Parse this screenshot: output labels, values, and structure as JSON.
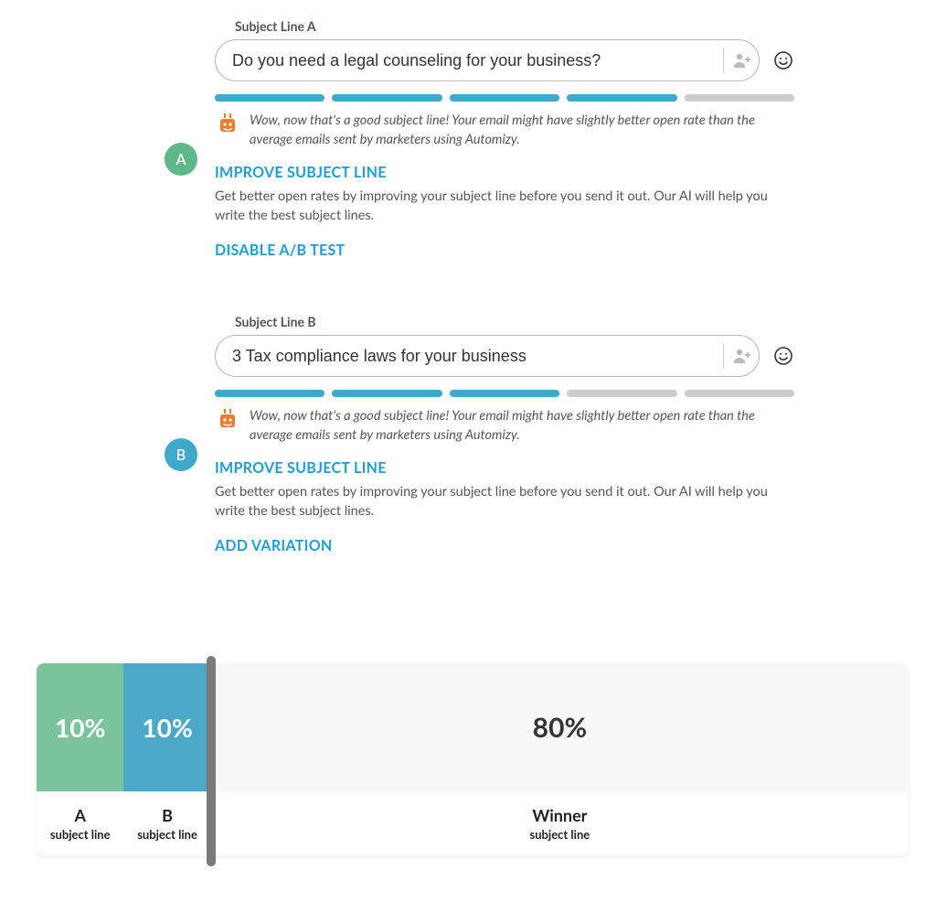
{
  "variations": {
    "a": {
      "label": "Subject Line A",
      "value": "Do you need a legal counseling for your business?",
      "badge": "A",
      "score_filled": 4,
      "score_total": 5,
      "feedback": "Wow, now that's a good subject line! Your email might have slightly better open rate than the average emails sent by marketers using Automizy.",
      "improve_label": "IMPROVE SUBJECT LINE",
      "improve_help": "Get better open rates by improving your subject line before you send it out. Our AI will help you write the best subject lines.",
      "action_label": "DISABLE A/B TEST"
    },
    "b": {
      "label": "Subject Line B",
      "value": "3 Tax compliance laws for your business",
      "badge": "B",
      "score_filled": 3,
      "score_total": 5,
      "feedback": "Wow, now that's a good subject line! Your email might have slightly better open rate than the average emails sent by marketers using Automizy.",
      "improve_label": "IMPROVE SUBJECT LINE",
      "improve_help": "Get better open rates by improving your subject line before you send it out. Our AI will help you write the best subject lines.",
      "action_label": "ADD VARIATION"
    }
  },
  "split": {
    "a": {
      "percent": "10%",
      "title": "A",
      "sub": "subject line"
    },
    "b": {
      "percent": "10%",
      "title": "B",
      "sub": "subject line"
    },
    "winner": {
      "percent": "80%",
      "title": "Winner",
      "sub": "subject line"
    }
  }
}
